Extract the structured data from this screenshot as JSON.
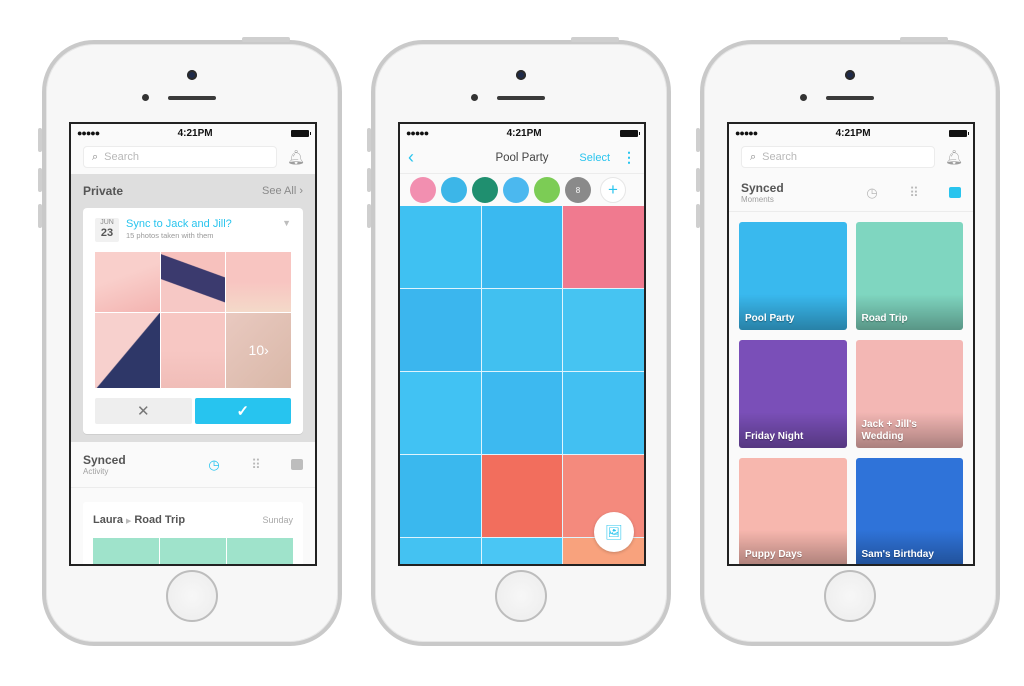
{
  "status_bar": {
    "signal": "●●●●● ",
    "wifi": "wifi",
    "time": "4:21PM"
  },
  "phone1": {
    "search_placeholder": "Search",
    "private_section": {
      "title": "Private",
      "see_all": "See All ›"
    },
    "sync_card": {
      "month": "JUN",
      "day": "23",
      "title": "Sync to Jack and Jill?",
      "subtitle": "15 photos taken with them",
      "more_count": "10›",
      "decline_icon": "✕",
      "accept_icon": "✓"
    },
    "synced_section": {
      "title": "Synced",
      "subtitle": "Activity",
      "active_tab": "activity"
    },
    "activity_item": {
      "from": "Laura",
      "album": "Road Trip",
      "when": "Sunday"
    }
  },
  "phone2": {
    "nav": {
      "back": "‹",
      "title": "Pool Party",
      "select": "Select",
      "more": "⋮"
    },
    "avatars": [
      {
        "color": "#f28fb0"
      },
      {
        "color": "#3cb6e8"
      },
      {
        "color": "#1f8f6f"
      },
      {
        "color": "#4bb8ef"
      },
      {
        "color": "#7ccc55"
      },
      {
        "color": "#8a8a8a",
        "label": "8"
      }
    ],
    "add_member": "+",
    "photos": [
      "#3fc1f2",
      "#3ab9f0",
      "#f07a8f",
      "#3bb6ee",
      "#41c0f0",
      "#46c4f2",
      "#41c2f3",
      "#3db9f0",
      "#42c0f2",
      "#3ab8ee",
      "#f26e5d",
      "#f48a7d",
      "#44c2f2",
      "#4ac6f4",
      "#f8a27d"
    ],
    "fab_icon": "add-photo"
  },
  "phone3": {
    "search_placeholder": "Search",
    "synced_section": {
      "title": "Synced",
      "subtitle": "Moments",
      "active_tab": "moments"
    },
    "moments": [
      {
        "label": "Pool Party",
        "color": "#39b9ee"
      },
      {
        "label": "Road Trip",
        "color": "#7fd6c0"
      },
      {
        "label": "Friday Night",
        "color": "#7a4fb8"
      },
      {
        "label": "Jack + Jill's Wedding",
        "color": "#f3b7b4"
      },
      {
        "label": "Puppy Days",
        "color": "#f7b7ae"
      },
      {
        "label": "Sam's Birthday",
        "color": "#2f73d9"
      }
    ]
  },
  "colors": {
    "accent": "#29c4ee"
  }
}
